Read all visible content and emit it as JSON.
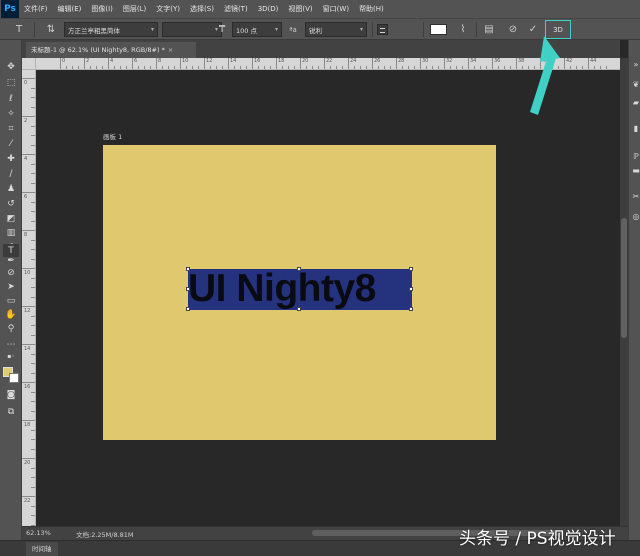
{
  "app": {
    "logo_text": "Ps",
    "menus": [
      "文件(F)",
      "编辑(E)",
      "图像(I)",
      "图层(L)",
      "文字(Y)",
      "选择(S)",
      "滤镜(T)",
      "3D(D)",
      "视图(V)",
      "窗口(W)",
      "帮助(H)"
    ]
  },
  "options_bar": {
    "font_family": "方正兰亭粗黑简体",
    "font_style": "",
    "font_size": "100 点",
    "antialias": "锐利",
    "button_3d": "3D",
    "text_color": "#ffffff"
  },
  "document": {
    "tab_title": "未标题-1 @ 62.1% (UI Nighty8, RGB/8#) *",
    "tab_close": "×",
    "artboard_label": "画板 1",
    "text_content": "UI Nighty8",
    "artboard_color": "#e0c86e",
    "selection_color": "#25327d"
  },
  "ruler_top": [
    "0",
    "2",
    "4",
    "6",
    "8",
    "10",
    "12",
    "14",
    "16",
    "18",
    "20",
    "22",
    "24",
    "26",
    "28",
    "30",
    "32",
    "34",
    "36",
    "38",
    "40",
    "42",
    "44"
  ],
  "ruler_left": [
    "0",
    "2",
    "4",
    "6",
    "8",
    "10",
    "12",
    "14",
    "16",
    "18",
    "20",
    "22"
  ],
  "status": {
    "zoom": "62.13%",
    "doc_info": "文档:2.25M/8.81M"
  },
  "timeline_tab": "时间轴",
  "watermark": "头条号 / PS视觉设计",
  "colors": {
    "foreground": "#e0ca72",
    "background": "#ffffff",
    "highlight": "#3fd1c6"
  }
}
